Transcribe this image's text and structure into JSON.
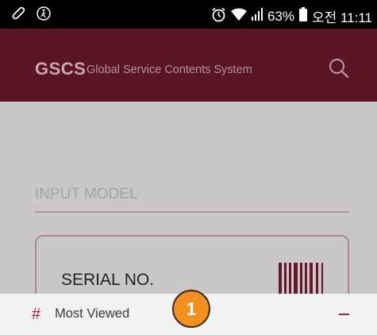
{
  "status_bar": {
    "battery": "63%",
    "time": "오전 11:11",
    "icons": [
      "pen-icon",
      "accessibility-icon",
      "alarm-icon",
      "wifi-icon",
      "signal-icon",
      "battery-icon"
    ]
  },
  "header": {
    "brand": "GSCS",
    "subtitle": "Global Service Contents System",
    "search_icon": "search-icon",
    "background": "#5a1525"
  },
  "main": {
    "model_input": {
      "placeholder": "INPUT MODEL",
      "value": ""
    },
    "serial_card": {
      "label": "SERIAL NO.",
      "icon": "barcode-icon"
    }
  },
  "bottom_bar": {
    "icon": "hash-icon",
    "label": "Most Viewed",
    "collapse_icon": "minus-icon",
    "accent": "#a5223c"
  },
  "badge": {
    "text": "1",
    "color": "#f4901f"
  }
}
